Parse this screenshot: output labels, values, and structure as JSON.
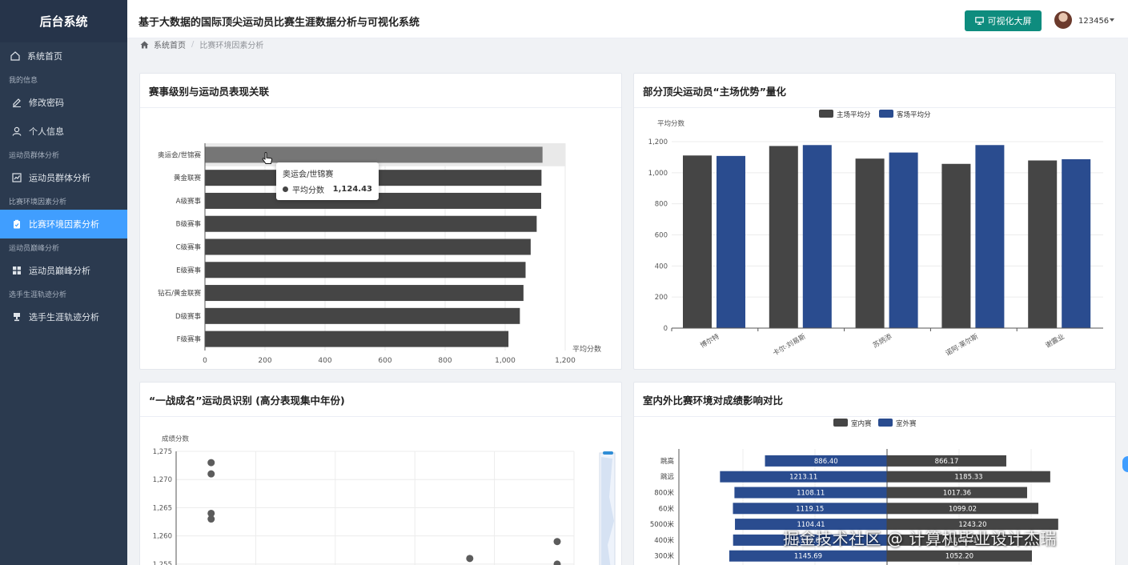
{
  "sidebar": {
    "brand": "后台系统",
    "items": [
      {
        "type": "item",
        "label": "系统首页",
        "icon": "home-icon"
      },
      {
        "type": "group",
        "label": "我的信息"
      },
      {
        "type": "item",
        "label": "修改密码",
        "icon": "edit-icon",
        "sub": true
      },
      {
        "type": "item",
        "label": "个人信息",
        "icon": "user-icon",
        "sub": true
      },
      {
        "type": "group",
        "label": "运动员群体分析"
      },
      {
        "type": "item",
        "label": "运动员群体分析",
        "icon": "chart-icon",
        "sub": true
      },
      {
        "type": "group",
        "label": "比赛环境因素分析"
      },
      {
        "type": "item",
        "label": "比赛环境因素分析",
        "icon": "clipboard-icon",
        "sub": true,
        "active": true
      },
      {
        "type": "group",
        "label": "运动员巅峰分析"
      },
      {
        "type": "item",
        "label": "运动员巅峰分析",
        "icon": "grid-icon",
        "sub": true
      },
      {
        "type": "group",
        "label": "选手生涯轨迹分析"
      },
      {
        "type": "item",
        "label": "选手生涯轨迹分析",
        "icon": "trophy-icon",
        "sub": true
      }
    ]
  },
  "header": {
    "title": "基于大数据的国际顶尖运动员比赛生涯数据分析与可视化系统",
    "screen_button": "可视化大屏",
    "username": "123456"
  },
  "breadcrumb": {
    "home": "系统首页",
    "current": "比赛环境因素分析"
  },
  "panels": {
    "p1": "赛事级别与运动员表现关联",
    "p2": "部分顶尖运动员“主场优势”量化",
    "p3": "“一战成名”运动员识别 (高分表现集中年份)",
    "p4": "室内外比赛环境对成绩影响对比"
  },
  "tooltip": {
    "title": "奥运会/世锦赛",
    "series": "平均分数",
    "value": "1,124.43"
  },
  "watermark": "掘金技术社区 @ 计算机毕业设计杰瑞",
  "colors": {
    "dark": "#454545",
    "blue": "#2a4c8f",
    "accent": "#409eff"
  },
  "chart_data": [
    {
      "type": "bar",
      "orientation": "horizontal",
      "categories": [
        "奥运会/世锦赛",
        "黄金联赛",
        "A级赛事",
        "B级赛事",
        "C级赛事",
        "E级赛事",
        "钻石/黄金联赛",
        "D级赛事",
        "F级赛事"
      ],
      "values": [
        1124.43,
        1121,
        1120,
        1105,
        1085,
        1068,
        1061,
        1049,
        1011
      ],
      "xlabel": "平均分数",
      "xlim": [
        0,
        1200
      ],
      "xticks": [
        "0",
        "200",
        "400",
        "600",
        "800",
        "1,000",
        "1,200"
      ]
    },
    {
      "type": "bar",
      "categories": [
        "博尔特",
        "卡尔·刘易斯",
        "苏炳添",
        "诺阿·莱尔斯",
        "谢震业"
      ],
      "series": [
        {
          "name": "主场平均分",
          "values": [
            1111,
            1172,
            1091,
            1057,
            1079
          ]
        },
        {
          "name": "客场平均分",
          "values": [
            1108,
            1178,
            1130,
            1178,
            1087
          ]
        }
      ],
      "ylabel": "平均分数",
      "ylim": [
        0,
        1200
      ],
      "yticks": [
        "0",
        "200",
        "400",
        "600",
        "800",
        "1,000",
        "1,200"
      ]
    },
    {
      "type": "scatter",
      "ylabel": "成绩分数",
      "ylim": [
        1252,
        1275
      ],
      "yticks": [
        "1,255",
        "1,260",
        "1,265",
        "1,270",
        "1,275"
      ],
      "points": [
        [
          0.05,
          1273
        ],
        [
          0.05,
          1271
        ],
        [
          0.05,
          1264
        ],
        [
          0.05,
          1263
        ],
        [
          0.76,
          1256
        ],
        [
          1.0,
          1259
        ],
        [
          1.0,
          1255
        ]
      ]
    },
    {
      "type": "bar",
      "orientation": "horizontal-diverging",
      "categories": [
        "跳高",
        "跳远",
        "800米",
        "60米",
        "5000米",
        "400米",
        "300米"
      ],
      "series": [
        {
          "name": "室内赛",
          "values": [
            866.17,
            1185.33,
            1017.36,
            1099.02,
            1243.2,
            1106.31,
            1052.2
          ]
        },
        {
          "name": "室外赛",
          "values": [
            886.4,
            1213.11,
            1108.11,
            1119.15,
            1104.41,
            1118.0,
            1145.69
          ]
        }
      ]
    }
  ]
}
